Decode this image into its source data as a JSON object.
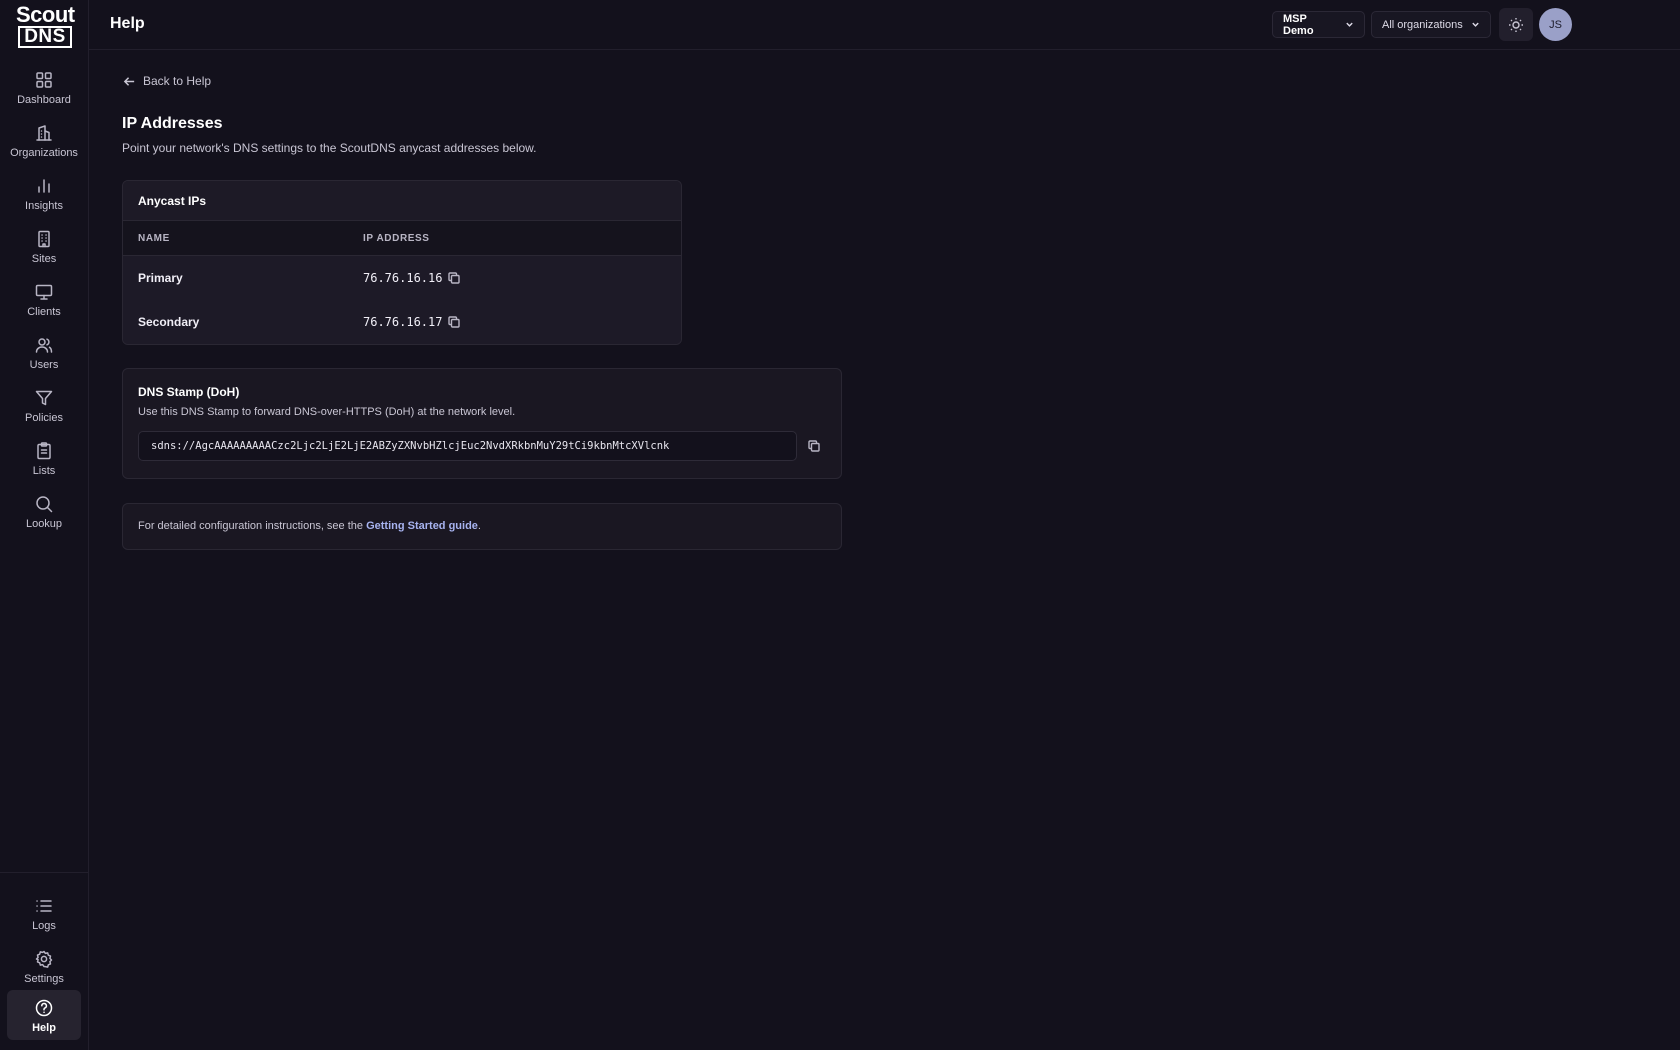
{
  "logo": {
    "line1": "Scout",
    "line2": "DNS"
  },
  "sidebar": {
    "items": [
      {
        "label": "Dashboard",
        "icon": "grid-icon"
      },
      {
        "label": "Organizations",
        "icon": "building-icon"
      },
      {
        "label": "Insights",
        "icon": "bar-chart-icon"
      },
      {
        "label": "Sites",
        "icon": "office-icon"
      },
      {
        "label": "Clients",
        "icon": "monitor-icon"
      },
      {
        "label": "Users",
        "icon": "users-icon"
      },
      {
        "label": "Policies",
        "icon": "filter-icon"
      },
      {
        "label": "Lists",
        "icon": "clipboard-icon"
      },
      {
        "label": "Lookup",
        "icon": "search-icon"
      }
    ],
    "bottom": [
      {
        "label": "Logs",
        "icon": "list-icon"
      },
      {
        "label": "Settings",
        "icon": "gear-icon"
      },
      {
        "label": "Help",
        "icon": "help-circle-icon",
        "active": true
      }
    ]
  },
  "header": {
    "title": "Help",
    "msp_selector": "MSP Demo",
    "org_selector": "All organizations",
    "avatar_initials": "JS"
  },
  "main": {
    "back_label": "Back to Help",
    "title": "IP Addresses",
    "description": "Point your network's DNS settings to the ScoutDNS anycast addresses below.",
    "anycast": {
      "heading": "Anycast IPs",
      "columns": [
        "NAME",
        "IP ADDRESS"
      ],
      "rows": [
        {
          "name": "Primary",
          "ip": "76.76.16.16"
        },
        {
          "name": "Secondary",
          "ip": "76.76.16.17"
        }
      ]
    },
    "stamp": {
      "heading": "DNS Stamp (DoH)",
      "description": "Use this DNS Stamp to forward DNS-over-HTTPS (DoH) at the network level.",
      "value": "sdns://AgcAAAAAAAAACzc2Ljc2LjE2LjE2ABZyZXNvbHZlcjEuc2NvdXRkbnMuY29tCi9kbnMtcXVlcnk"
    },
    "info": {
      "prefix": "For detailed configuration instructions, see the ",
      "link": "Getting Started guide",
      "suffix": "."
    }
  },
  "colors": {
    "background": "#13111c",
    "card": "#1a1722",
    "accent_link": "#a7b3f0",
    "avatar": "#9aa0c8"
  }
}
